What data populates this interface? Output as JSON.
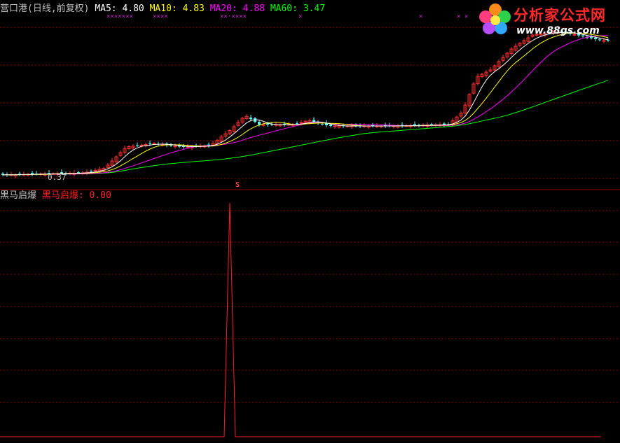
{
  "header": {
    "stock_title": "营口港(日线,前复权)",
    "ma5_label": "MA5:",
    "ma5_value": "4.80",
    "ma10_label": "MA10:",
    "ma10_value": "4.83",
    "ma20_label": "MA20:",
    "ma20_value": "4.88",
    "ma60_label": "MA60:",
    "ma60_value": "3.47"
  },
  "indicator_header": {
    "name": "黑马启爆",
    "series_label": "黑马启爆:",
    "series_value": "0.00"
  },
  "logo": {
    "title": "分析家公式网",
    "url": "www.88gs.com"
  },
  "markers": {
    "x_marks": [
      "×××××××",
      "××××",
      "××·××××",
      "×",
      "×",
      "× ×"
    ],
    "signal": "S",
    "min_price_label": "0.37"
  },
  "colors": {
    "background": "#000000",
    "grid": "#8b0000",
    "ma5": "#ffffff",
    "ma10": "#ffff00",
    "ma20": "#ff00ff",
    "ma60": "#00ff00",
    "candle_up": "#ff3030",
    "candle_down": "#54ffff",
    "indicator": "#ff2020",
    "title_text": "#c0c0c0"
  },
  "chart_data": [
    {
      "type": "line",
      "title": "营口港(日线,前复权)",
      "series": [
        {
          "name": "MA5",
          "values": [
            4.8
          ]
        },
        {
          "name": "MA10",
          "values": [
            4.83
          ]
        },
        {
          "name": "MA20",
          "values": [
            4.88
          ]
        },
        {
          "name": "MA60",
          "values": [
            3.47
          ]
        }
      ]
    },
    {
      "type": "line",
      "title": "黑马启爆",
      "series": [
        {
          "name": "黑马启爆",
          "values": [
            0,
            0,
            0,
            0,
            0,
            0,
            1,
            0,
            0,
            0,
            0,
            0,
            0,
            0,
            0,
            0,
            0,
            0,
            0,
            0
          ]
        }
      ],
      "ylim": [
        0,
        1
      ]
    }
  ]
}
